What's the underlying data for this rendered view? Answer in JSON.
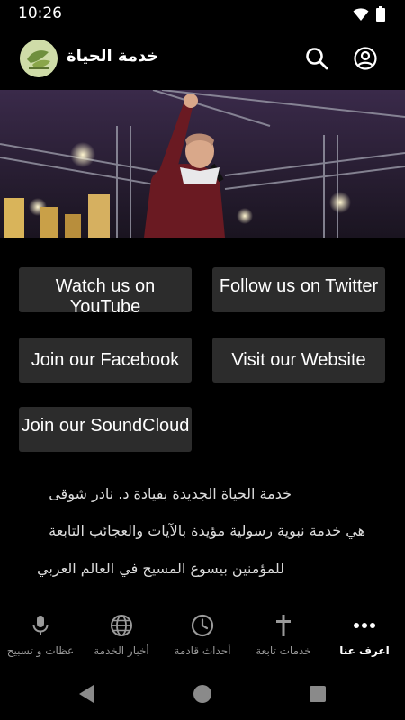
{
  "status": {
    "time": "10:26"
  },
  "app": {
    "title": "خدمة الحياة"
  },
  "buttons": {
    "youtube": "Watch us on YouTube",
    "twitter": "Follow us on Twitter",
    "facebook": "Join our Facebook",
    "website": "Visit our Website",
    "soundcloud": "Join our SoundCloud"
  },
  "about": {
    "lines": [
      "خدمة الحياة الجديدة بقيادة د. نادر شوقى",
      "هي خدمة نبوية رسولية مؤيدة بالآيات والعجائب التابعة",
      "للمؤمنين بيسوع المسيح في العالم العربي"
    ]
  },
  "bottom_nav": [
    {
      "label": "اعرف عنا",
      "icon": "more-horiz-icon",
      "active": true
    },
    {
      "label": "خدمات تابعة",
      "icon": "cross-icon",
      "active": false
    },
    {
      "label": "أحداث قادمة",
      "icon": "clock-icon",
      "active": false
    },
    {
      "label": "أخبار الخدمة",
      "icon": "globe-icon",
      "active": false
    },
    {
      "label": "عظات و تسبيح",
      "icon": "microphone-icon",
      "active": false
    }
  ],
  "colors": {
    "background": "#000000",
    "button": "#2c2c2c",
    "nav_inactive": "#9a9a9a"
  }
}
